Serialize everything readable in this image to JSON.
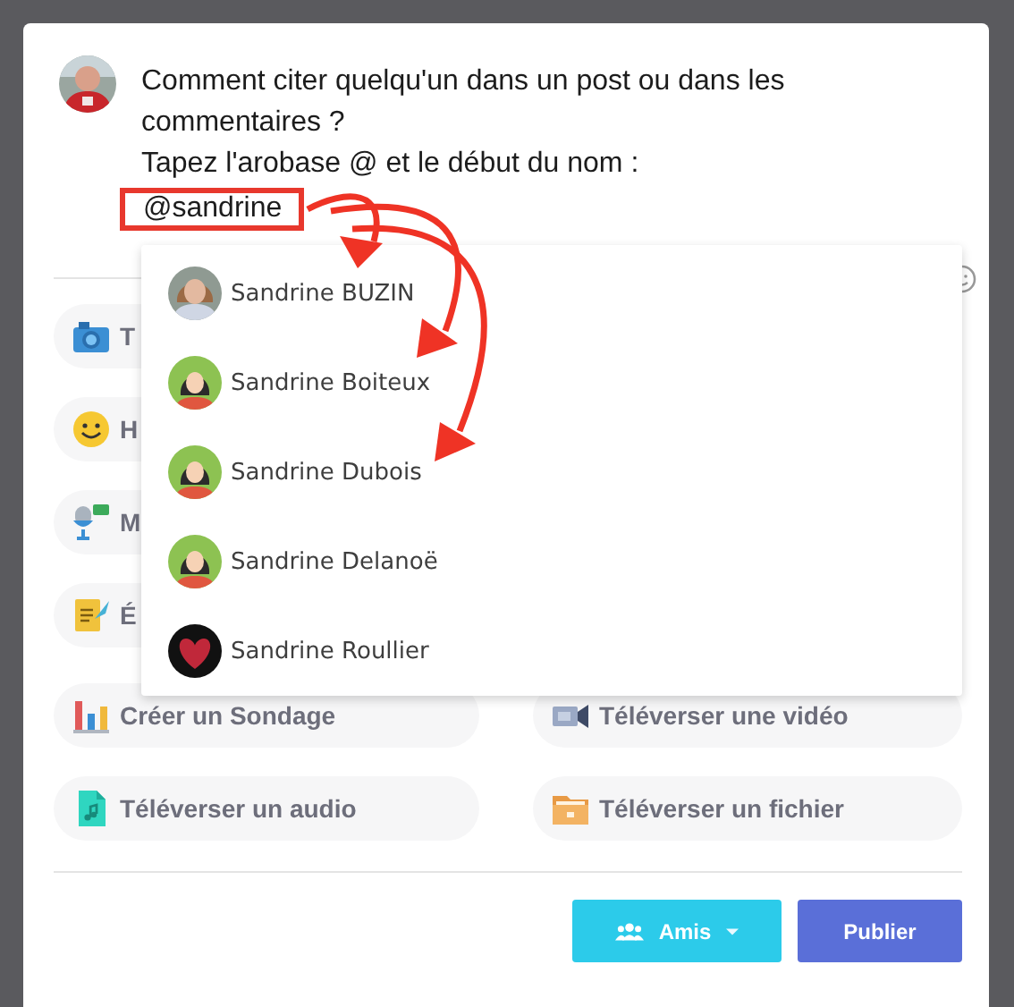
{
  "post": {
    "text": "Comment citer quelqu'un dans un post ou dans les commentaires ?",
    "instruction": "Tapez l'arobase @ et le début du nom :",
    "mention": "@sandrine"
  },
  "suggestions": [
    {
      "name": "Sandrine BUZIN"
    },
    {
      "name": "Sandrine Boiteux",
      "kind": "illustration"
    },
    {
      "name": "Sandrine Dubois",
      "kind": "illustration"
    },
    {
      "name": "Sandrine Delanoë",
      "kind": "illustration"
    },
    {
      "name": "Sandrine Roullier",
      "kind": "heart"
    }
  ],
  "left_actions": [
    {
      "label": "T",
      "kind": "camera"
    },
    {
      "label": "H",
      "kind": "smiley"
    },
    {
      "label": "M",
      "kind": "microphone"
    },
    {
      "label": "É",
      "kind": "scroll"
    },
    {
      "label": "Créer un Sondage",
      "kind": "chart"
    },
    {
      "label": "Téléverser un audio",
      "kind": "audio"
    }
  ],
  "right_actions": [
    {
      "label": "Téléverser une vidéo",
      "kind": "video"
    },
    {
      "label": "Téléverser un fichier",
      "kind": "folder"
    }
  ],
  "footer": {
    "privacy": "Amis",
    "publish": "Publier"
  }
}
